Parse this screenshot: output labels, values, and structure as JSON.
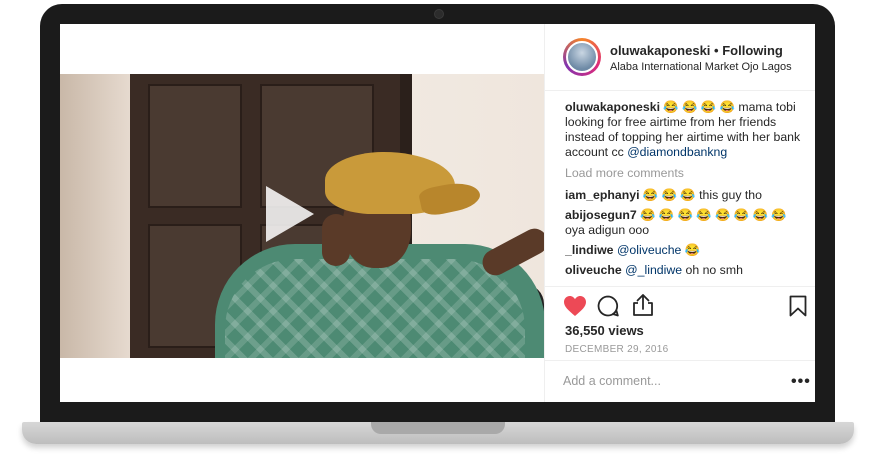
{
  "post": {
    "username": "oluwakaponeski",
    "follow_status": "• Following",
    "location": "Alaba International Market Ojo Lagos",
    "caption": {
      "username": "oluwakaponeski",
      "text": " 😂 😂 😂 😂  mama tobi looking for free airtime from her friends instead of topping her airtime with her bank account cc ",
      "mention": "@diamondbankng"
    },
    "load_more": "Load more comments",
    "comments": [
      {
        "user": "iam_ephanyi",
        "text": " 😂 😂 😂  this guy tho",
        "mention": ""
      },
      {
        "user": "abijosegun7",
        "text": " 😂 😂 😂 😂 😂 😂 😂 😂  oya adigun ooo",
        "mention": ""
      },
      {
        "user": "_lindiwe",
        "text": " ",
        "mention": "@oliveuche",
        "after": " 😂"
      },
      {
        "user": "oliveuche",
        "text": " ",
        "mention": "@_lindiwe",
        "after": " oh no smh"
      }
    ],
    "views": "36,550 views",
    "date": "DECEMBER 29, 2016",
    "add_comment_placeholder": "Add a comment...",
    "more_label": "•••"
  },
  "colors": {
    "like": "#ed4956",
    "mention": "#003569",
    "muted": "#999999",
    "text": "#262626"
  },
  "icons": [
    "play-icon",
    "heart-icon",
    "comment-icon",
    "share-icon",
    "bookmark-icon",
    "more-icon"
  ]
}
